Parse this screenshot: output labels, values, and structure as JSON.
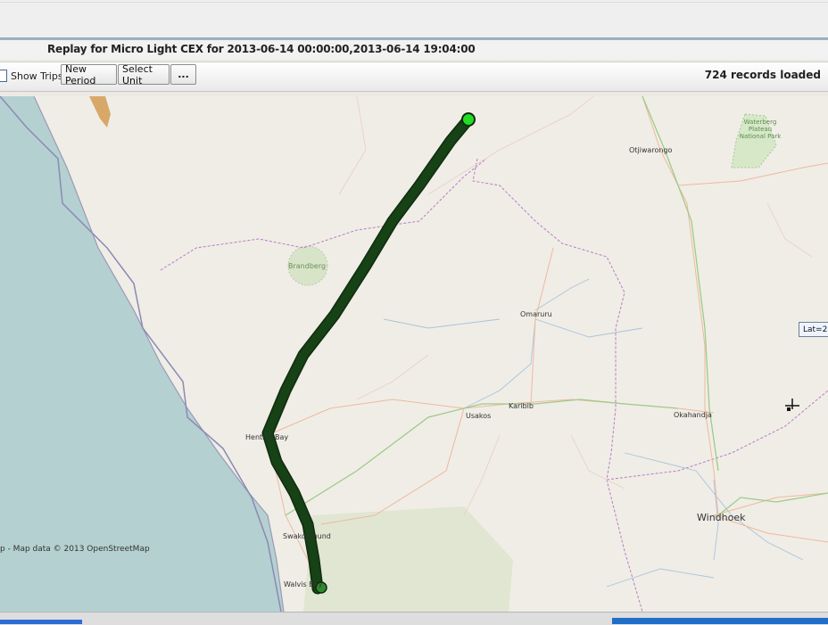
{
  "window": {
    "title": "Replay for Micro Light CEX for 2013-06-14 00:00:00,2013-06-14 19:04:00"
  },
  "toolbar": {
    "show_trips_label": "Show Trips",
    "show_trips_checked": false,
    "new_period_label": "New Period",
    "select_unit_label": "Select Unit",
    "more_label": "...",
    "records_status": "724 records loaded"
  },
  "map": {
    "attribution": "p - Map data © 2013 OpenStreetMap",
    "places": {
      "otjiwarongo": "Otjiwarongo",
      "brandberg": "Brandberg",
      "omaruru": "Omaruru",
      "usakos": "Usakos",
      "karibib": "Karibib",
      "okahandja": "Okahandja",
      "windhoek": "Windhoek",
      "henties_bay": "Henties Bay",
      "swakopmund": "Swakopmund",
      "walvis_bay": "Walvis Bay"
    },
    "park_label": "Waterberg Plateau National Park",
    "tooltip": "Lat=2",
    "colors": {
      "sea": "#b5d0d0",
      "land": "#f0ede6",
      "track_fill": "#2f8a2f",
      "track_stroke": "#0f2a0f",
      "start_marker": "#22dd22"
    }
  }
}
